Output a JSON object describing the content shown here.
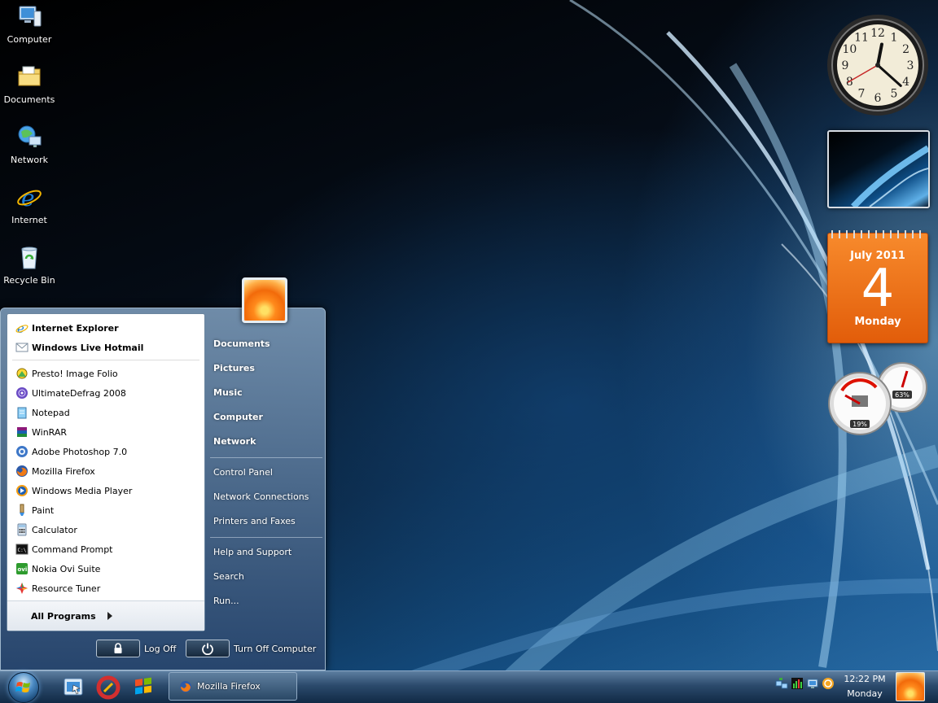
{
  "desktop": {
    "icons": [
      {
        "label": "Computer",
        "icon": "computer-icon"
      },
      {
        "label": "Documents",
        "icon": "documents-folder-icon"
      },
      {
        "label": "Network",
        "icon": "network-icon"
      },
      {
        "label": "Internet",
        "icon": "internet-explorer-icon"
      },
      {
        "label": "Recycle Bin",
        "icon": "recycle-bin-icon"
      }
    ]
  },
  "gadgets": {
    "clock": {
      "hour": 12,
      "minute": 22,
      "second": 40,
      "numerals": [
        "12",
        "1",
        "2",
        "3",
        "4",
        "5",
        "6",
        "7",
        "8",
        "9",
        "10",
        "11"
      ]
    },
    "calendar": {
      "month_year": "July 2011",
      "day": "4",
      "weekday": "Monday"
    },
    "cpu_meter": {
      "cpu": "19%",
      "memory": "63%"
    }
  },
  "start_menu": {
    "pinned": [
      {
        "label": "Internet Explorer",
        "icon": "internet-explorer-icon"
      },
      {
        "label": "Windows Live Hotmail",
        "icon": "hotmail-icon"
      }
    ],
    "recent": [
      {
        "label": "Presto! Image Folio",
        "icon": "image-folio-icon"
      },
      {
        "label": "UltimateDefrag 2008",
        "icon": "defrag-icon"
      },
      {
        "label": "Notepad",
        "icon": "notepad-icon"
      },
      {
        "label": "WinRAR",
        "icon": "winrar-icon"
      },
      {
        "label": "Adobe Photoshop 7.0",
        "icon": "photoshop-icon"
      },
      {
        "label": "Mozilla Firefox",
        "icon": "firefox-icon"
      },
      {
        "label": "Windows Media Player",
        "icon": "media-player-icon"
      },
      {
        "label": "Paint",
        "icon": "paint-icon"
      },
      {
        "label": "Calculator",
        "icon": "calculator-icon"
      },
      {
        "label": "Command Prompt",
        "icon": "command-prompt-icon"
      },
      {
        "label": "Nokia Ovi Suite",
        "icon": "ovi-suite-icon"
      },
      {
        "label": "Resource Tuner",
        "icon": "resource-tuner-icon"
      }
    ],
    "all_programs": "All Programs",
    "places": [
      "Documents",
      "Pictures",
      "Music",
      "Computer",
      "Network"
    ],
    "settings": [
      "Control Panel",
      "Network Connections",
      "Printers and Faxes"
    ],
    "help": [
      "Help and Support",
      "Search",
      "Run..."
    ],
    "log_off": "Log Off",
    "turn_off": "Turn Off Computer"
  },
  "taskbar": {
    "quick_launch": [
      "show-desktop-icon",
      "ccleaner-icon",
      "windows-flag-icon"
    ],
    "task_button": "Mozilla Firefox",
    "tray_icons": [
      "network-tray-icon",
      "meter-tray-icon",
      "wireless-tray-icon",
      "update-tray-icon"
    ],
    "time": "12:22 PM",
    "day": "Monday"
  },
  "colors": {
    "calendar_orange": "#ef7418",
    "menu_blue": "#46648a",
    "taskbar_blue": "#2b4a6c"
  }
}
